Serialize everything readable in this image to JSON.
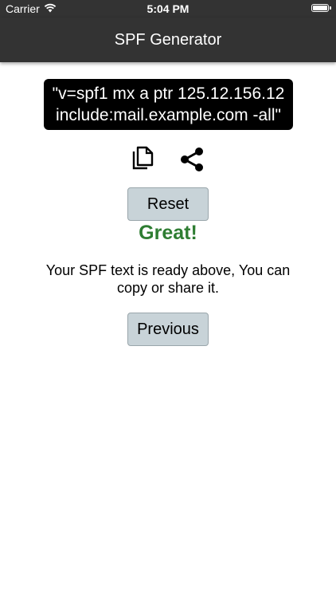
{
  "status_bar": {
    "carrier": "Carrier",
    "time": "5:04 PM"
  },
  "nav": {
    "title": "SPF Generator"
  },
  "spf": {
    "text": "\"v=spf1 mx a ptr 125.12.156.12\ninclude:mail.example.com -all\""
  },
  "actions": {
    "copy_icon": "copy-icon",
    "share_icon": "share-icon"
  },
  "buttons": {
    "reset_label": "Reset",
    "previous_label": "Previous"
  },
  "result": {
    "title": "Great!",
    "message": "Your SPF text is ready above, You can copy or share it."
  },
  "colors": {
    "nav_background": "#333333",
    "success_text": "#2e7d32",
    "button_background": "#c8d3d8"
  }
}
